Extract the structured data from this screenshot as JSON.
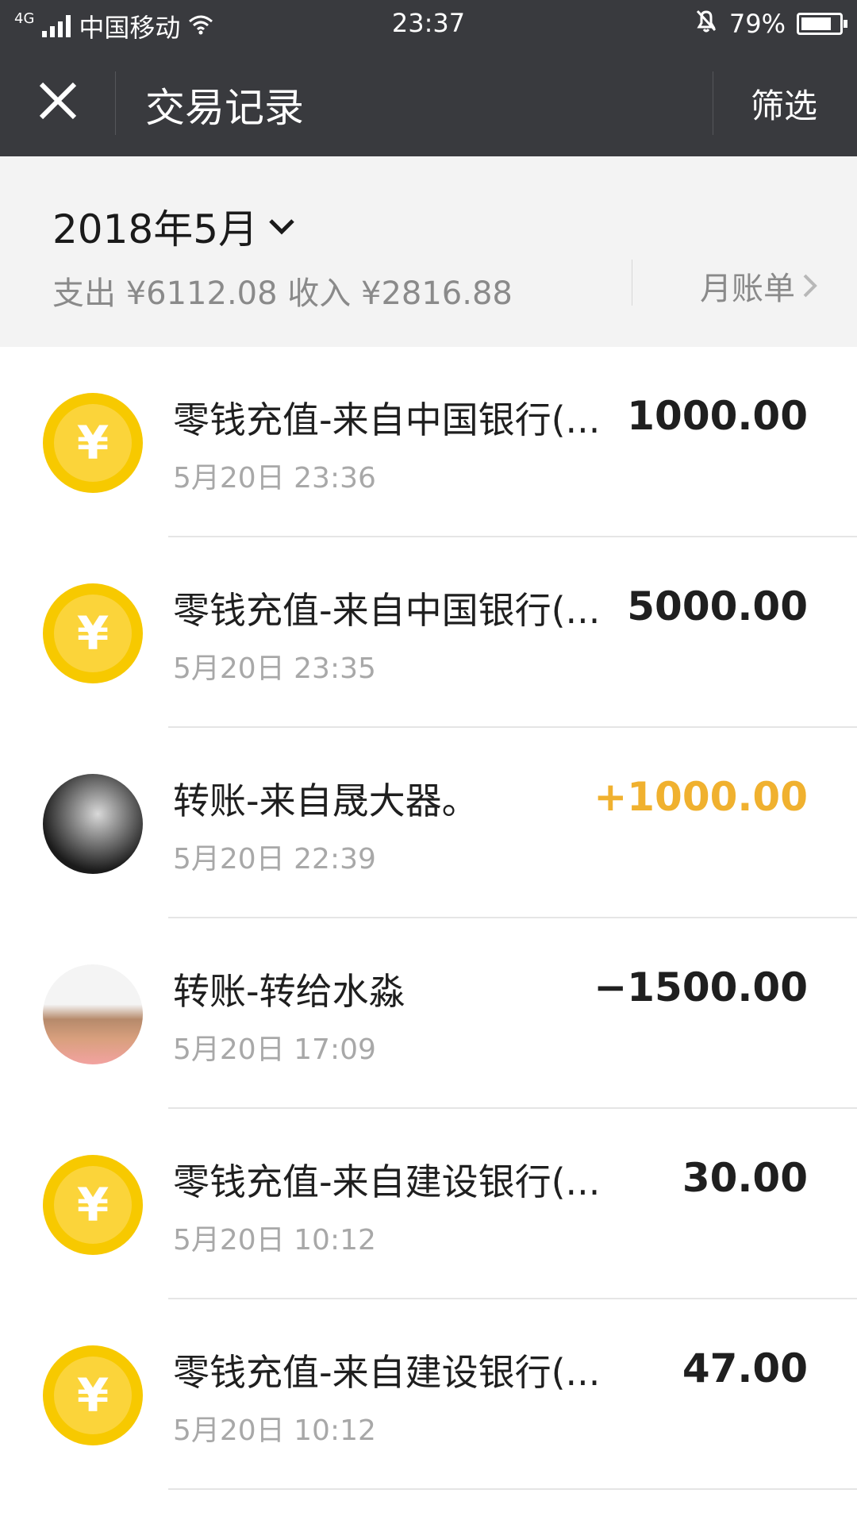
{
  "status_bar": {
    "network": "4G",
    "carrier": "中国移动",
    "time": "23:37",
    "battery": "79%"
  },
  "nav": {
    "title": "交易记录",
    "filter_label": "筛选",
    "close_icon": "close-icon"
  },
  "summary": {
    "month": "2018年5月",
    "totals": "支出 ¥6112.08 收入 ¥2816.88",
    "bill_label": "月账单"
  },
  "transactions": [
    {
      "name": "零钱充值-来自中国银行(...",
      "date": "5月20日 23:36",
      "amount": "1000.00",
      "icon": "yuan-coin-icon"
    },
    {
      "name": "零钱充值-来自中国银行(...",
      "date": "5月20日 23:35",
      "amount": "5000.00",
      "icon": "yuan-coin-icon"
    },
    {
      "name": "转账-来自晟大器。",
      "date": "5月20日 22:39",
      "amount": "+1000.00",
      "icon": "user-avatar"
    },
    {
      "name": "转账-转给水淼",
      "date": "5月20日 17:09",
      "amount": "−1500.00",
      "icon": "user-avatar"
    },
    {
      "name": "零钱充值-来自建设银行(...",
      "date": "5月20日 10:12",
      "amount": "30.00",
      "icon": "yuan-coin-icon"
    },
    {
      "name": "零钱充值-来自建设银行(...",
      "date": "5月20日 10:12",
      "amount": "47.00",
      "icon": "yuan-coin-icon"
    }
  ],
  "colors": {
    "header_bg": "#393a3e",
    "income": "#f0b12f",
    "coin": "#f7c900"
  }
}
